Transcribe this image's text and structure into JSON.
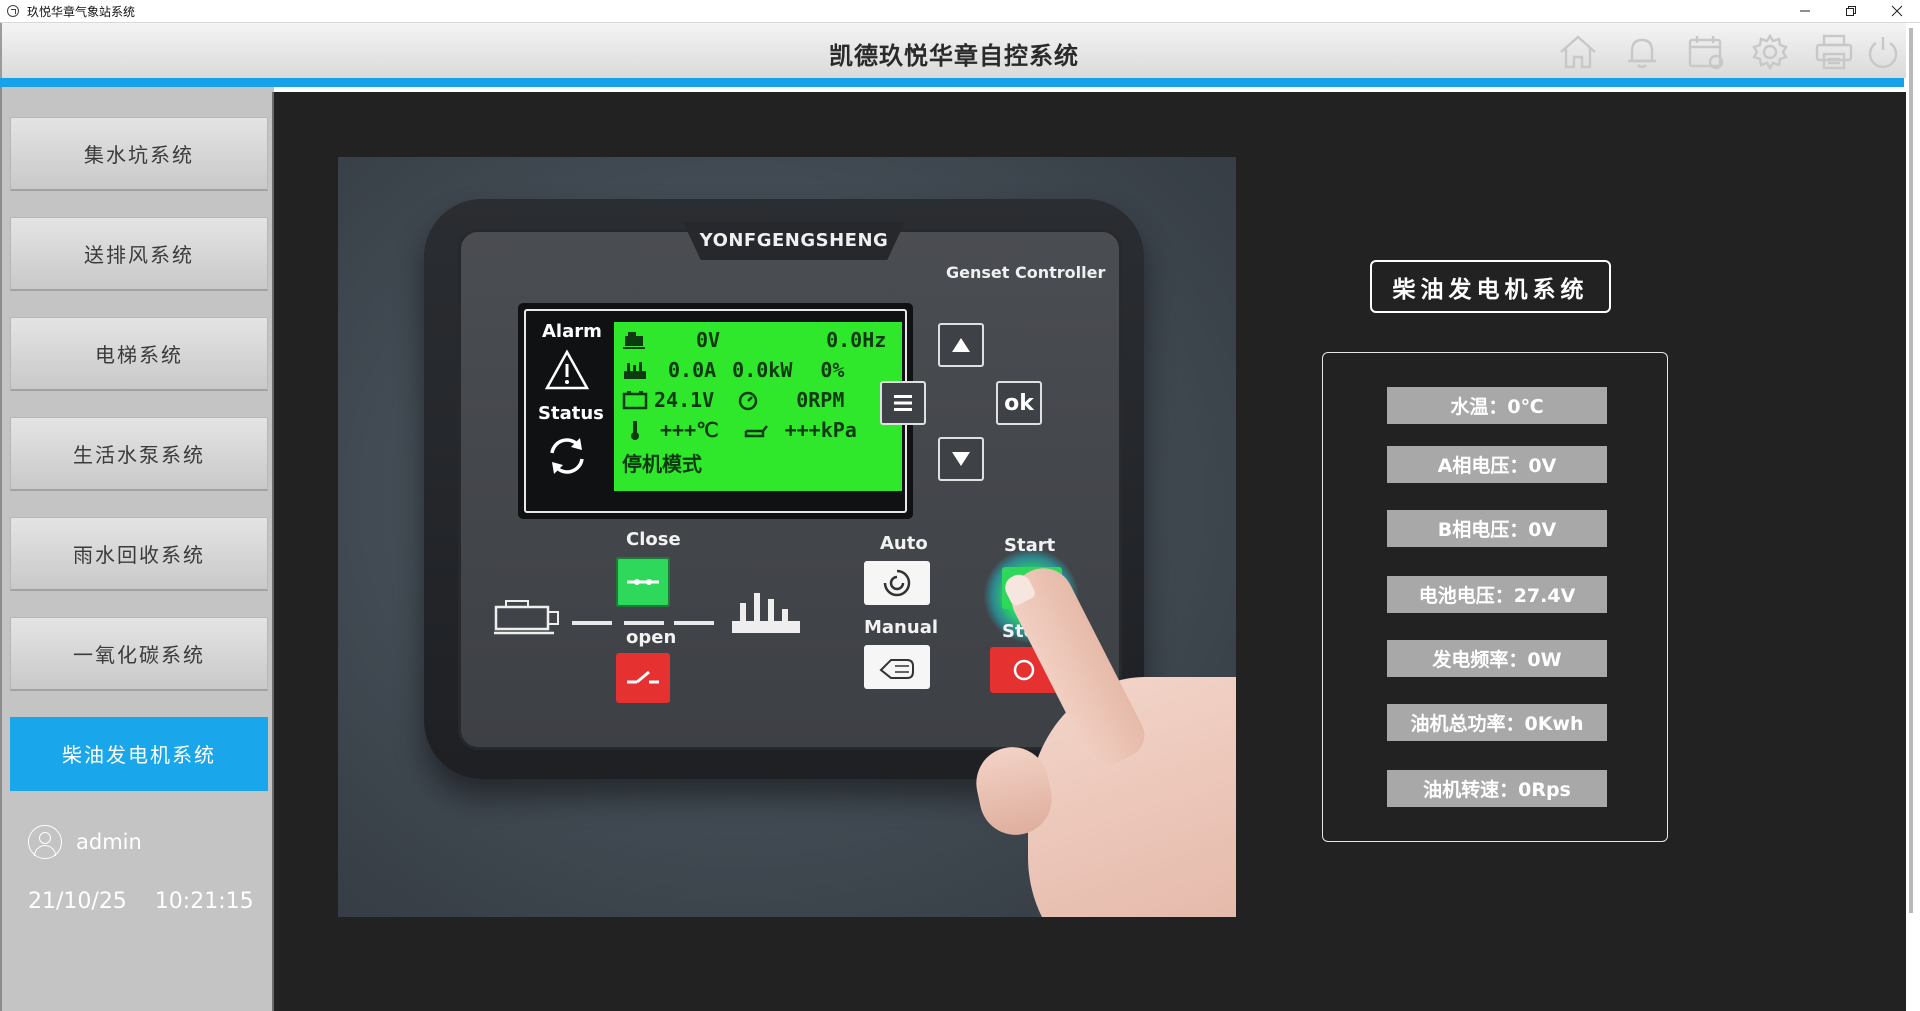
{
  "window": {
    "title": "玖悦华章气象站系统",
    "controls": [
      "minimize",
      "restore",
      "close"
    ]
  },
  "header": {
    "title": "凯德玖悦华章自控系统",
    "icons": [
      "home-icon",
      "bell-icon",
      "calendar-icon",
      "gear-icon",
      "printer-icon",
      "power-icon"
    ],
    "accent_color": "#16a2e9"
  },
  "sidebar": {
    "items": [
      {
        "label": "集水坑系统",
        "active": false
      },
      {
        "label": "送排风系统",
        "active": false
      },
      {
        "label": "电梯系统",
        "active": false
      },
      {
        "label": "生活水泵系统",
        "active": false
      },
      {
        "label": "雨水回收系统",
        "active": false
      },
      {
        "label": "一氧化碳系统",
        "active": false
      },
      {
        "label": "柴油发电机系统",
        "active": true
      }
    ],
    "active_color": "#19a6ea",
    "user": "admin",
    "date": "21/10/25",
    "time": "10:21:15"
  },
  "controller_image": {
    "brand": "YONFGENGSHENG",
    "model_label": "Genset Controller",
    "alarm_label": "Alarm",
    "status_label": "Status",
    "lcd": {
      "voltage": "0V",
      "frequency": "0.0Hz",
      "current": "0.0A",
      "power": "0.0kW",
      "percent": "0%",
      "battery": "24.1V",
      "rpm": "0RPM",
      "temperature": "+++℃",
      "pressure": "+++kPa",
      "mode": "停机模式"
    },
    "keys": {
      "ok": "ok"
    },
    "labels": {
      "close": "Close",
      "open": "open",
      "auto": "Auto",
      "manual": "Manual",
      "start": "Start",
      "stop": "Stop"
    }
  },
  "system_panel": {
    "title": "柴油发电机系统",
    "readings": [
      "水温：0℃",
      "A相电压：0V",
      "B相电压：0V",
      "电池电压：27.4V",
      "发电频率：0W",
      "油机总功率：0Kwh",
      "油机转速：0Rps"
    ]
  }
}
